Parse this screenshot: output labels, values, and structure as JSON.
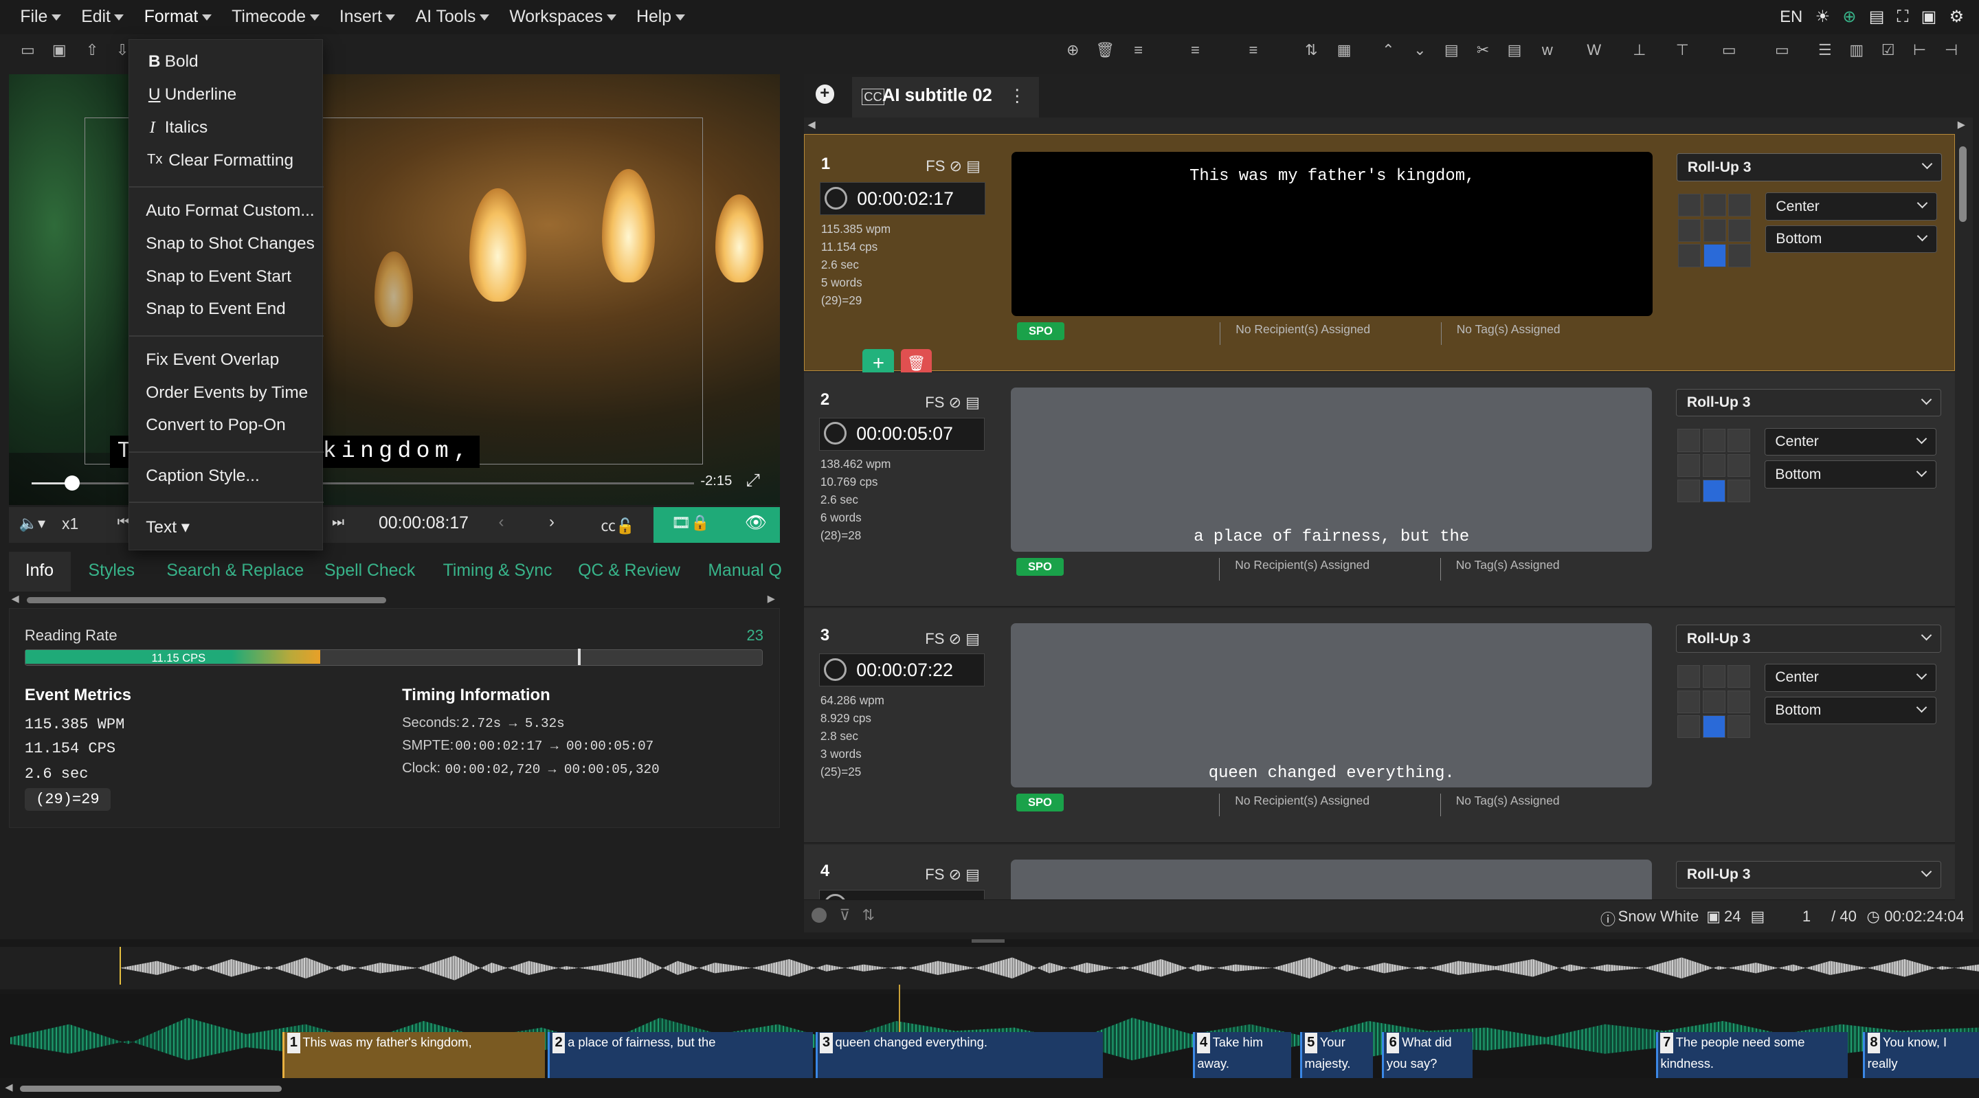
{
  "menubar": {
    "items": [
      "File",
      "Edit",
      "Format",
      "Timecode",
      "Insert",
      "AI Tools",
      "Workspaces",
      "Help"
    ],
    "language": "EN"
  },
  "format_menu": {
    "items": [
      "Bold",
      "Underline",
      "Italics",
      "Clear Formatting",
      "Auto Format Custom...",
      "Snap to Shot Changes",
      "Snap to Event Start",
      "Snap to Event End",
      "Fix Event Overlap",
      "Order Events by Time",
      "Convert to Pop-On",
      "Caption Style...",
      "Text"
    ],
    "icons": {
      "bold": "B",
      "underline": "U",
      "italics": "I",
      "clear": "Tx"
    }
  },
  "video": {
    "caption_overlay": "T        father's kingdom,",
    "remaining": "-2:15",
    "speed": "x1",
    "timecode": "00:00:08:17"
  },
  "info_tabs": [
    "Info",
    "Styles",
    "Search & Replace",
    "Spell Check",
    "Timing & Sync",
    "QC & Review",
    "Manual Q"
  ],
  "info": {
    "reading_rate_label": "Reading Rate",
    "reading_rate_max": "23",
    "reading_rate_value": "11.15 CPS",
    "reading_rate_fraction": 0.4,
    "metrics_title": "Event Metrics",
    "metrics": [
      "115.385 WPM",
      "11.154 CPS",
      "2.6 sec"
    ],
    "metrics_badge": "(29)=29",
    "timing_title": "Timing Information",
    "seconds_label": "Seconds:",
    "seconds_value": "2.72s → 5.32s",
    "smpte_label": "SMPTE:",
    "smpte_value": "00:00:02:17 → 00:00:05:07",
    "clock_label": "Clock:",
    "clock_value": "00:00:02,720 → 00:00:05,320"
  },
  "subtitle_tab": {
    "label": "AI subtitle 02"
  },
  "events": [
    {
      "num": "1",
      "fs": "FS",
      "tc": "00:00:02:17",
      "wpm": "115.385 wpm",
      "cps": "11.154 cps",
      "sec": "2.6 sec",
      "words": "5 words",
      "calc": "(29)=29",
      "text": "This was my father's kingdom,",
      "spo": "SPO",
      "recipients": "No Recipient(s) Assigned",
      "tags": "No Tag(s) Assigned",
      "style": "Roll-Up 3",
      "align": "Center",
      "pos": "Bottom"
    },
    {
      "num": "2",
      "fs": "FS",
      "tc": "00:00:05:07",
      "wpm": "138.462 wpm",
      "cps": "10.769 cps",
      "sec": "2.6 sec",
      "words": "6 words",
      "calc": "(28)=28",
      "text": "a place of fairness, but the",
      "spo": "SPO",
      "recipients": "No Recipient(s) Assigned",
      "tags": "No Tag(s) Assigned",
      "style": "Roll-Up 3",
      "align": "Center",
      "pos": "Bottom"
    },
    {
      "num": "3",
      "fs": "FS",
      "tc": "00:00:07:22",
      "wpm": "64.286 wpm",
      "cps": "8.929 cps",
      "sec": "2.8 sec",
      "words": "3 words",
      "calc": "(25)=25",
      "text": "queen changed everything.",
      "spo": "SPO",
      "recipients": "No Recipient(s) Assigned",
      "tags": "No Tag(s) Assigned",
      "style": "Roll-Up 3",
      "align": "Center",
      "pos": "Bottom"
    },
    {
      "num": "4",
      "fs": "FS",
      "style": "Roll-Up 3"
    }
  ],
  "statusbar": {
    "project": "Snow White",
    "count": "24",
    "current": "1",
    "total": "/ 40",
    "duration": "00:02:24:04"
  },
  "timeline": [
    {
      "n": "1",
      "text": "This was my father's kingdom,"
    },
    {
      "n": "2",
      "text": "a place of fairness, but the"
    },
    {
      "n": "3",
      "text": "queen changed everything."
    },
    {
      "n": "4",
      "text": "Take him away."
    },
    {
      "n": "5",
      "text": "Your majesty."
    },
    {
      "n": "6",
      "text": "What did you say?"
    },
    {
      "n": "7",
      "text": "The people need some kindness."
    },
    {
      "n": "8",
      "text": "You know, I really"
    }
  ],
  "colors": {
    "accent": "#38b48a",
    "active_event": "#5c4520",
    "spo": "#1aa24a",
    "delete": "#e05050",
    "add": "#22b27c",
    "position_active": "#2a6ad8"
  }
}
